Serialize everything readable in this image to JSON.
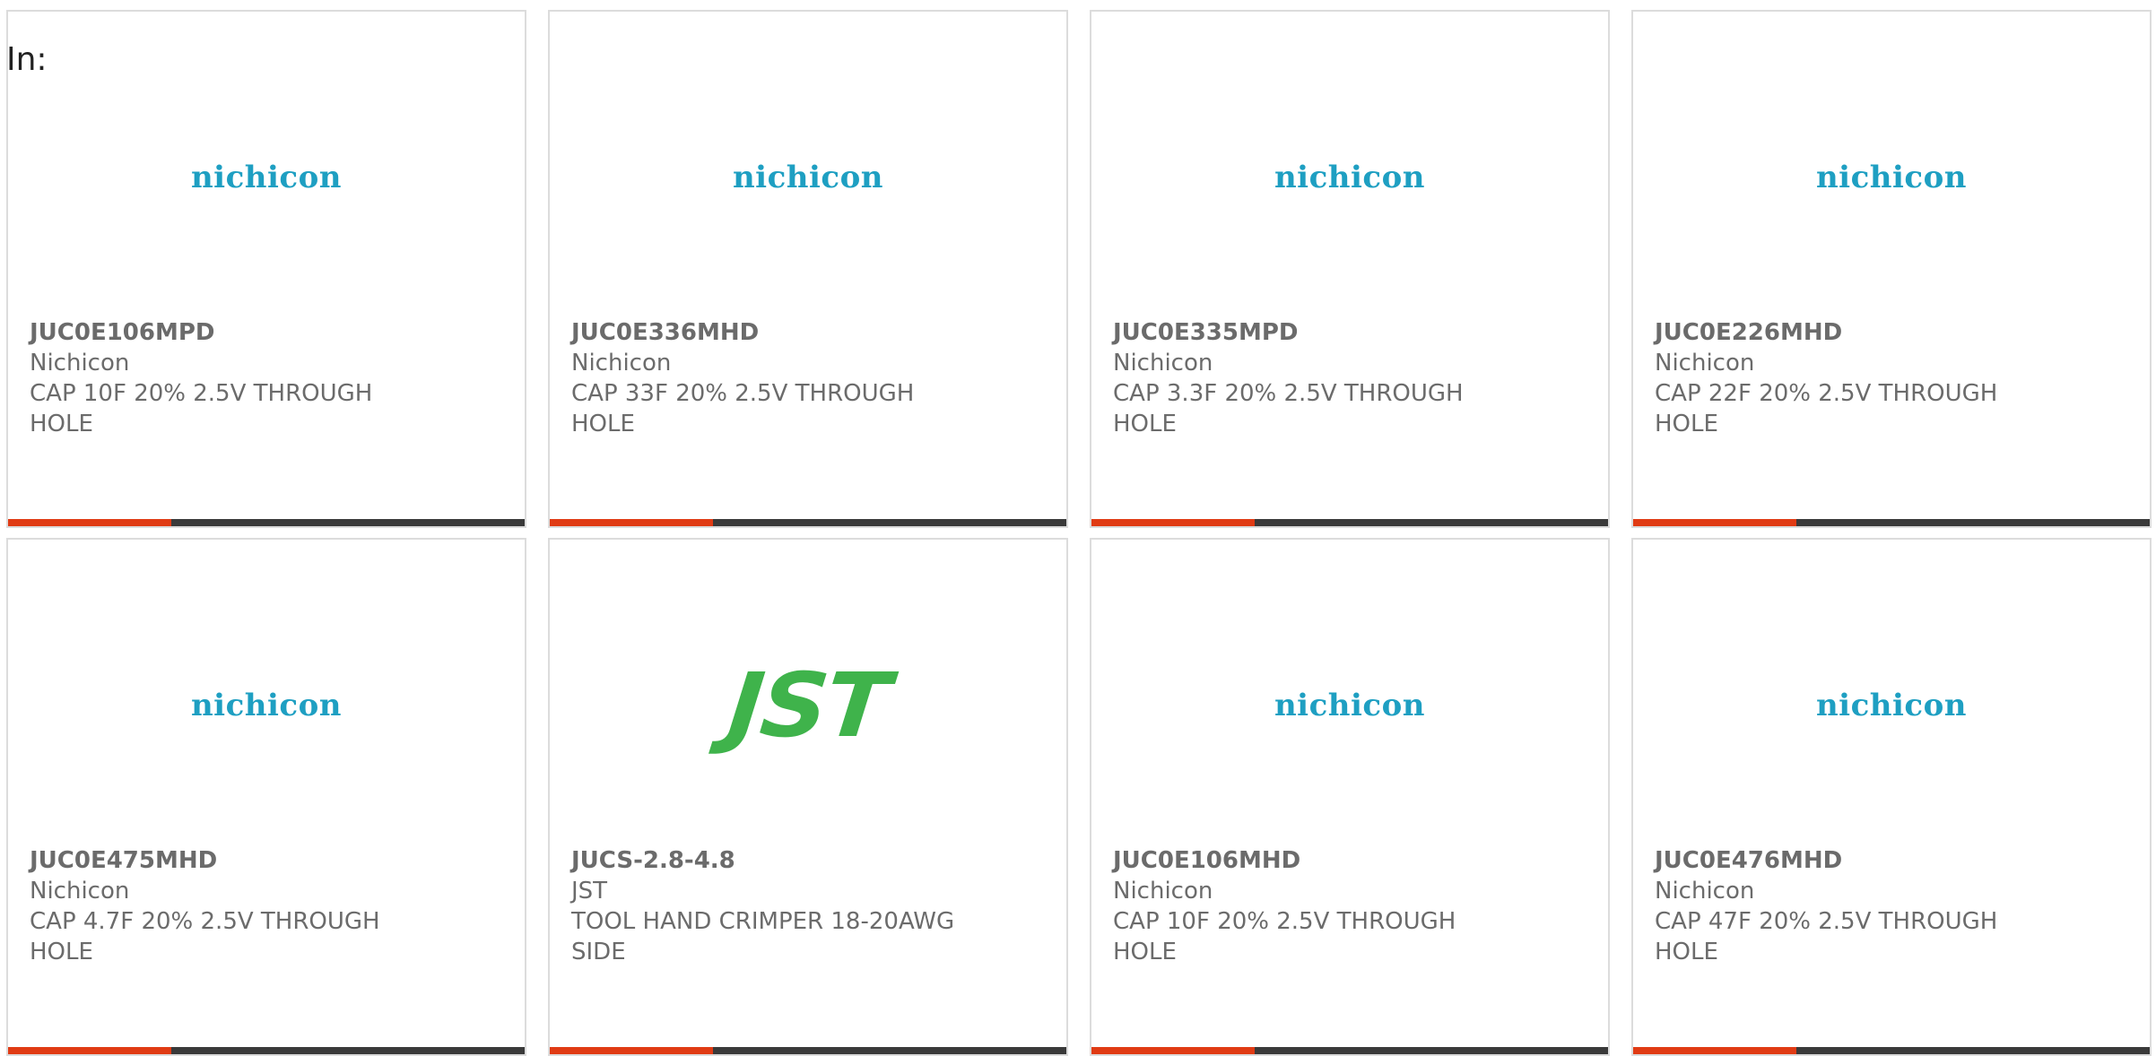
{
  "header": {
    "in_label": "In:"
  },
  "colors": {
    "nichicon_logo": "#1e9fc2",
    "jst_logo": "#3fb34b",
    "accent_bar": "#e03b14",
    "bar_dark": "#3a3a3a",
    "card_border": "#dcdcdc",
    "text_gray": "#6b6b6b"
  },
  "products": [
    {
      "part_number": "JUC0E106MPD",
      "manufacturer": "Nichicon",
      "description": "CAP 10F 20% 2.5V THROUGH HOLE",
      "logo_text": "nichicon",
      "logo_icon": "nichicon-logo"
    },
    {
      "part_number": "JUC0E336MHD",
      "manufacturer": "Nichicon",
      "description": "CAP 33F 20% 2.5V THROUGH HOLE",
      "logo_text": "nichicon",
      "logo_icon": "nichicon-logo"
    },
    {
      "part_number": "JUC0E335MPD",
      "manufacturer": "Nichicon",
      "description": "CAP 3.3F 20% 2.5V THROUGH HOLE",
      "logo_text": "nichicon",
      "logo_icon": "nichicon-logo"
    },
    {
      "part_number": "JUC0E226MHD",
      "manufacturer": "Nichicon",
      "description": "CAP 22F 20% 2.5V THROUGH HOLE",
      "logo_text": "nichicon",
      "logo_icon": "nichicon-logo"
    },
    {
      "part_number": "JUC0E475MHD",
      "manufacturer": "Nichicon",
      "description": "CAP 4.7F 20% 2.5V THROUGH HOLE",
      "logo_text": "nichicon",
      "logo_icon": "nichicon-logo"
    },
    {
      "part_number": "JUCS-2.8-4.8",
      "manufacturer": "JST",
      "description": "TOOL HAND CRIMPER 18-20AWG SIDE",
      "logo_text": "JST",
      "logo_icon": "jst-logo"
    },
    {
      "part_number": "JUC0E106MHD",
      "manufacturer": "Nichicon",
      "description": "CAP 10F 20% 2.5V THROUGH HOLE",
      "logo_text": "nichicon",
      "logo_icon": "nichicon-logo"
    },
    {
      "part_number": "JUC0E476MHD",
      "manufacturer": "Nichicon",
      "description": "CAP 47F 20% 2.5V THROUGH HOLE",
      "logo_text": "nichicon",
      "logo_icon": "nichicon-logo"
    }
  ]
}
